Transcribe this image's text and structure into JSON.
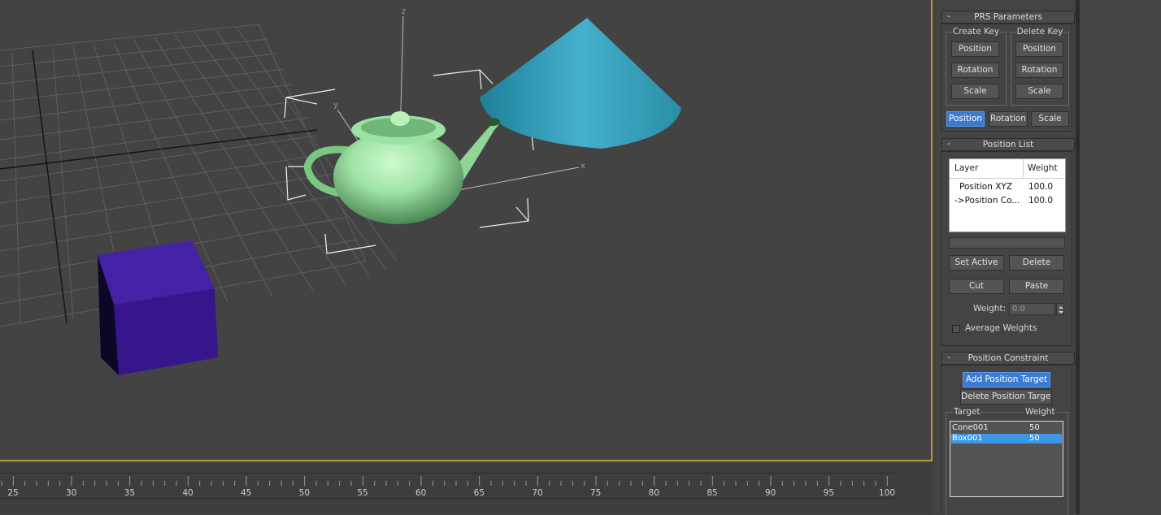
{
  "viewport": {
    "axis_labels": {
      "z": "z",
      "y": "y",
      "x": "x"
    },
    "colors": {
      "grid": "#5f5f5f",
      "teapot": "#9ee6a5",
      "cone": "#3ea8c4",
      "box": "#3a1e8e",
      "bracket": "#f0f0f0"
    }
  },
  "timeline": {
    "ticks": [
      "25",
      "30",
      "35",
      "40",
      "45",
      "50",
      "55",
      "60",
      "65",
      "70",
      "75",
      "80",
      "85",
      "90",
      "95",
      "100"
    ]
  },
  "prs": {
    "title": "PRS Parameters",
    "collapse": "-",
    "create_key": {
      "title": "Create Key",
      "position": "Position",
      "rotation": "Rotation",
      "scale": "Scale"
    },
    "delete_key": {
      "title": "Delete Key",
      "position": "Position",
      "rotation": "Rotation",
      "scale": "Scale"
    },
    "tabs": {
      "position": "Position",
      "rotation": "Rotation",
      "scale": "Scale"
    }
  },
  "poslist": {
    "title": "Position List",
    "collapse": "-",
    "header": {
      "layer": "Layer",
      "weight": "Weight"
    },
    "rows": [
      {
        "layer": "Position XYZ",
        "weight": "100.0"
      },
      {
        "layer": "->Position Co...",
        "weight": "100.0"
      }
    ],
    "set_active": "Set Active",
    "delete": "Delete",
    "cut": "Cut",
    "paste": "Paste",
    "weight_label": "Weight:",
    "weight_value": "0.0",
    "avg_label": "Average Weights"
  },
  "constraint": {
    "title": "Position Constraint",
    "collapse": "-",
    "add_target": "Add Position Target",
    "delete_target": "Delete Position Target",
    "target_header": "Target",
    "weight_header": "Weight",
    "targets": [
      {
        "name": "Cone001",
        "weight": "50"
      },
      {
        "name": "Box001",
        "weight": "50"
      }
    ]
  }
}
